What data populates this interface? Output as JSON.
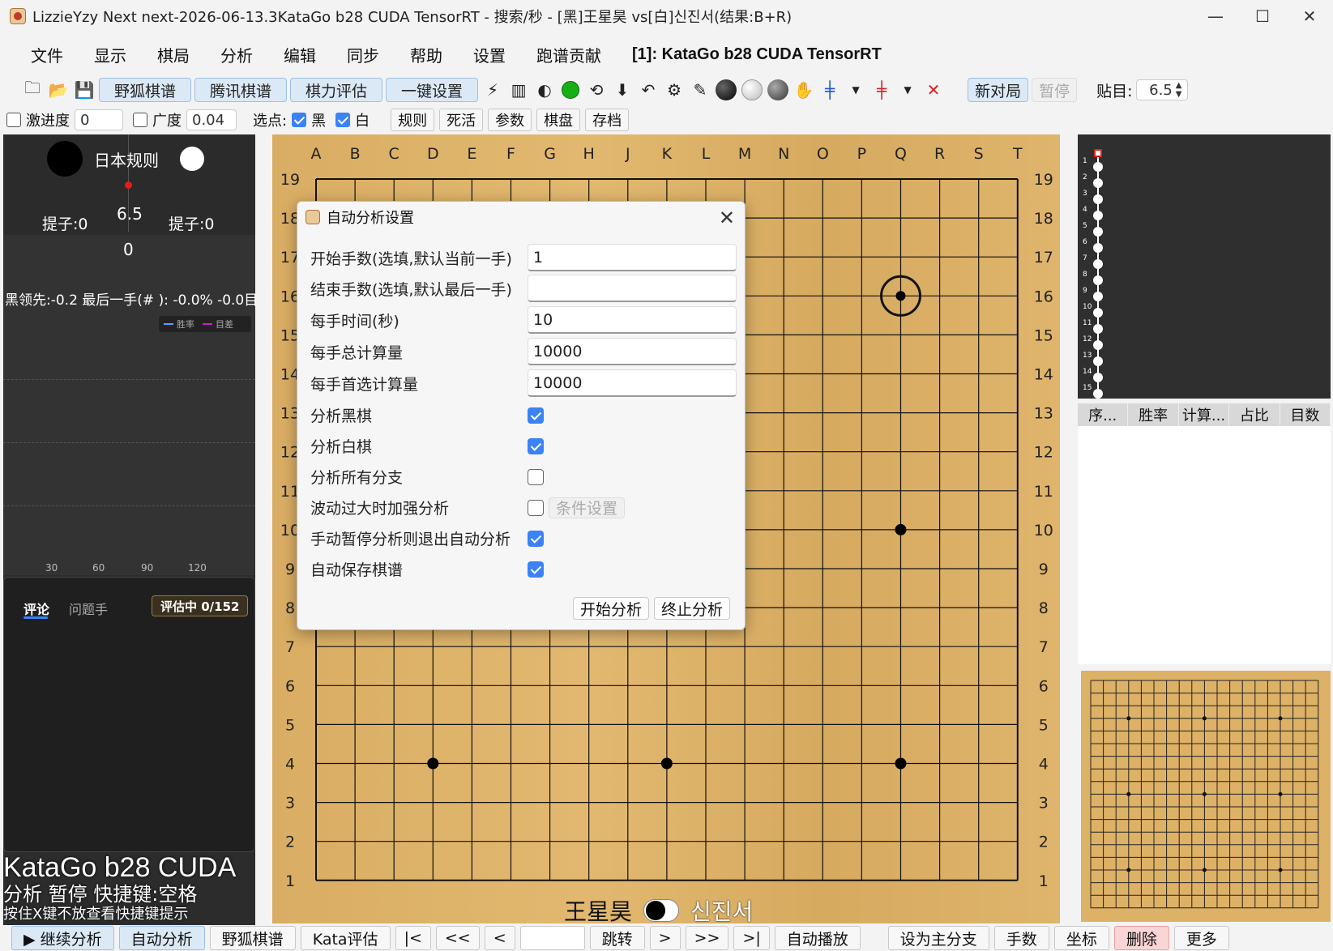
{
  "window": {
    "title": "LizzieYzy Next next-2026-06-13.3KataGo b28 CUDA TensorRT - 搜索/秒 - [黑]王星昊 vs[白]신진서(结果:B+R)",
    "minimize": "—",
    "maximize": "☐",
    "close": "✕"
  },
  "menu": {
    "items": [
      "文件",
      "显示",
      "棋局",
      "分析",
      "编辑",
      "同步",
      "帮助",
      "设置",
      "跑谱贡献"
    ],
    "engine": "[1]: KataGo b28 CUDA TensorRT"
  },
  "toolbar1": {
    "yehu": "野狐棋谱",
    "tencent": "腾讯棋谱",
    "strength": "棋力评估",
    "oneclick": "一键设置",
    "newgame": "新对局",
    "pause": "暂停",
    "komi_label": "贴目:",
    "komi_value": "6.5"
  },
  "toolbar2": {
    "aggr_label": "激进度",
    "aggr_value": "0",
    "width_label": "广度",
    "width_value": "0.04",
    "pick_label": "选点:",
    "black": "黑",
    "white": "白",
    "rules": "规则",
    "life": "死活",
    "params": "参数",
    "board": "棋盘",
    "archive": "存档"
  },
  "score": {
    "rule": "日本规则",
    "komi": "6.5",
    "cap_black": "提子:0",
    "cap_white": "提子:0"
  },
  "graph": {
    "zero": "0",
    "lead": "黑领先:-0.2 最后一手(#  ): -0.0% -0.0目",
    "legend_winrate": "胜率",
    "legend_score": "目差",
    "axis": [
      "30",
      "60",
      "90",
      "120"
    ]
  },
  "comments": {
    "tab_comment": "评论",
    "tab_problem": "问题手",
    "badge": "评估中 0/152"
  },
  "engine_info": {
    "name": "KataGo b28 CUDA",
    "status": "分析 暂停  快捷键:空格",
    "hint": "按住X键不放查看快捷键提示"
  },
  "board": {
    "columns": [
      "A",
      "B",
      "C",
      "D",
      "E",
      "F",
      "G",
      "H",
      "J",
      "K",
      "L",
      "M",
      "N",
      "O",
      "P",
      "Q",
      "R",
      "S",
      "T"
    ],
    "rows": [
      "19",
      "18",
      "17",
      "16",
      "15",
      "14",
      "13",
      "12",
      "11",
      "10",
      "9",
      "8",
      "7",
      "6",
      "5",
      "4",
      "3",
      "2",
      "1"
    ],
    "stones": [
      {
        "coord": "Q16",
        "color": "black",
        "last": true
      },
      {
        "coord": "Q10",
        "color": "black"
      },
      {
        "coord": "D4",
        "color": "black"
      },
      {
        "coord": "K4",
        "color": "black"
      },
      {
        "coord": "Q4",
        "color": "black"
      }
    ]
  },
  "players": {
    "black": "王星昊",
    "white": "신진서"
  },
  "movelist": {
    "numbers": [
      "1",
      "2",
      "3",
      "4",
      "5",
      "6",
      "7",
      "8",
      "9",
      "10",
      "11",
      "12",
      "13",
      "14",
      "15"
    ]
  },
  "table": {
    "headers": [
      "序...",
      "胜率",
      "计算...",
      "占比",
      "目数"
    ]
  },
  "dialog": {
    "title": "自动分析设置",
    "start_label": "开始手数(选填,默认当前一手)",
    "start_value": "1",
    "end_label": "结束手数(选填,默认最后一手)",
    "end_value": "",
    "time_label": "每手时间(秒)",
    "time_value": "10",
    "total_label": "每手总计算量",
    "total_value": "10000",
    "first_label": "每手首选计算量",
    "first_value": "10000",
    "black_label": "分析黑棋",
    "white_label": "分析白棋",
    "branches_label": "分析所有分支",
    "swing_label": "波动过大时加强分析",
    "cond_btn": "条件设置",
    "exit_label": "手动暂停分析则退出自动分析",
    "autosave_label": "自动保存棋谱",
    "start_btn": "开始分析",
    "stop_btn": "终止分析"
  },
  "bottombar": {
    "continue": "▶ 继续分析",
    "auto": "自动分析",
    "yehu": "野狐棋谱",
    "kata": "Kata评估",
    "first": "|<",
    "back10": "<<",
    "back": "<",
    "jump": "跳转",
    "fwd": ">",
    "fwd10": ">>",
    "last": ">|",
    "autoplay": "自动播放",
    "mainbranch": "设为主分支",
    "movenum": "手数",
    "coords": "坐标",
    "delete": "删除",
    "more": "更多"
  }
}
